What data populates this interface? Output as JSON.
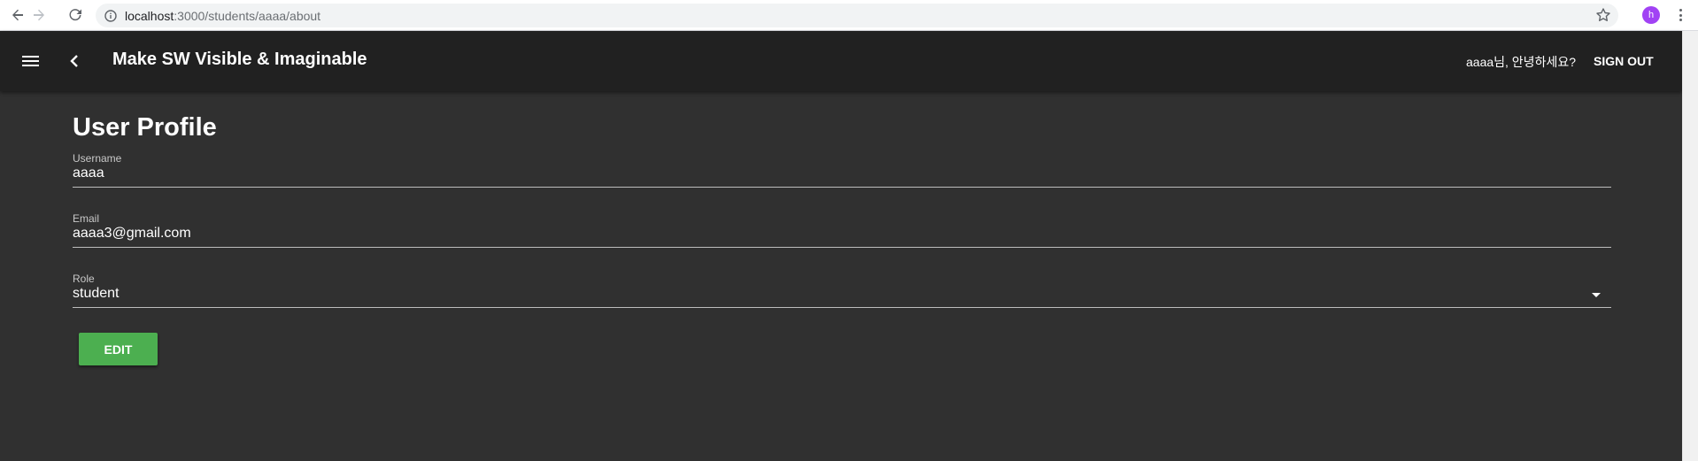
{
  "browser": {
    "url_host": "localhost",
    "url_rest": ":3000/students/aaaa/about",
    "profile_initial": "h"
  },
  "appbar": {
    "title": "Make SW Visible & Imaginable",
    "greeting": "aaaa님, 안녕하세요?",
    "signout_label": "SIGN OUT"
  },
  "profile": {
    "title": "User Profile",
    "username": {
      "label": "Username",
      "value": "aaaa"
    },
    "email": {
      "label": "Email",
      "value": "aaaa3@gmail.com"
    },
    "role": {
      "label": "Role",
      "value": "student"
    },
    "edit_label": "EDIT"
  },
  "colors": {
    "appbar_bg": "#212121",
    "page_bg": "#303030",
    "edit_button": "#4caf50",
    "avatar": "#a142f4"
  },
  "icons": [
    "back-arrow-icon",
    "forward-arrow-icon",
    "reload-icon",
    "info-icon",
    "star-icon",
    "more-vert-icon",
    "hamburger-menu-icon",
    "chevron-left-icon",
    "dropdown-arrow-icon"
  ]
}
